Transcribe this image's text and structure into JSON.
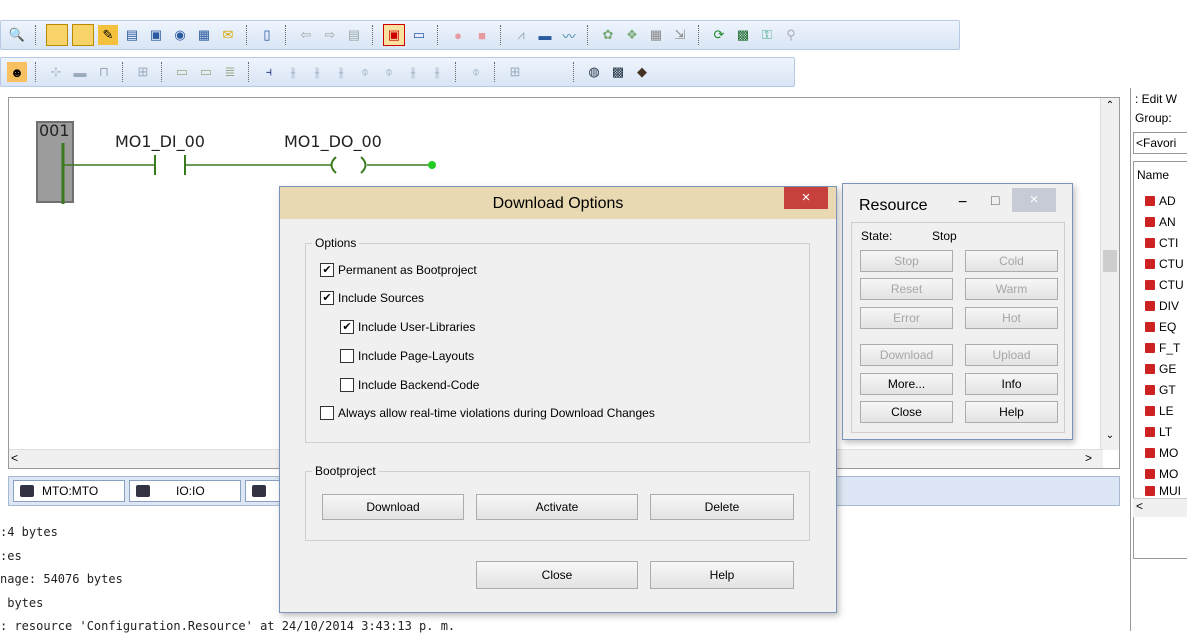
{
  "toolbar": {
    "row1_icons": [
      "search-icon",
      "window-icon",
      "window2-icon",
      "pencil-icon",
      "ladder-icon",
      "monitor-icon",
      "compile-icon",
      "memory-icon",
      "note-icon",
      "page-icon",
      "back-icon",
      "forward-icon",
      "list-icon",
      "build-icon",
      "config-icon",
      "record-icon",
      "stop-icon",
      "plot-icon",
      "view-icon",
      "wave-icon",
      "tools-icon",
      "resource-icon",
      "table-icon",
      "export-icon",
      "refresh-icon",
      "device-icon",
      "key-icon",
      "link-icon"
    ],
    "row2_icons": [
      "person-icon",
      "insert-icon",
      "block-icon",
      "branch-icon",
      "function-icon",
      "coil-icon",
      "coil2-icon",
      "stack-icon",
      "contact-no-icon",
      "contact-nc-icon",
      "contact-p-icon",
      "contact-n-icon",
      "coil-set-icon",
      "coil-reset-icon",
      "coil-p-icon",
      "coil-n-icon",
      "jump-icon",
      "return-icon",
      "globe-icon",
      "save-icon",
      "debug-icon"
    ]
  },
  "editor": {
    "rung_number": "001",
    "contact_var": "MO1_DI_00",
    "coil_var": "MO1_DO_00"
  },
  "tabs": [
    {
      "label": "MTO:MTO"
    },
    {
      "label": "IO:IO"
    }
  ],
  "output_lines": [
    ":4 bytes",
    ":es",
    "nage: 54076 bytes",
    " bytes",
    ": resource 'Configuration.Resource' at 24/10/2014 3:43:13 p. m."
  ],
  "right_panel": {
    "title": ": Edit W",
    "group_label": "Group:",
    "group_value": "<Favori",
    "column_header": "Name",
    "items": [
      "AD",
      "AN",
      "CTI",
      "CTU",
      "CTU",
      "DIV",
      "EQ",
      "F_T",
      "GE",
      "GT",
      "LE",
      "LT",
      "MO",
      "MO",
      "MUI"
    ]
  },
  "download_dialog": {
    "title": "Download Options",
    "options_group": "Options",
    "checkboxes": [
      {
        "label": "Permanent as Bootproject",
        "checked": "✔"
      },
      {
        "label": "Include Sources",
        "checked": "✔"
      },
      {
        "label": "Include User-Libraries",
        "checked": "✔"
      },
      {
        "label": "Include Page-Layouts",
        "checked": ""
      },
      {
        "label": "Include Backend-Code",
        "checked": ""
      },
      {
        "label": "Always allow real-time violations during Download Changes",
        "checked": ""
      }
    ],
    "bootproject_group": "Bootproject",
    "download_label": "Download",
    "activate_label": "Activate",
    "delete_label": "Delete",
    "close_label": "Close",
    "help_label": "Help",
    "close_icon": "×"
  },
  "resource_dialog": {
    "title": "Resource",
    "state_label": "State:",
    "state_value": "Stop",
    "buttons": {
      "stop": "Stop",
      "cold": "Cold",
      "reset": "Reset",
      "warm": "Warm",
      "error": "Error",
      "hot": "Hot",
      "download": "Download",
      "upload": "Upload",
      "more": "More...",
      "info": "Info",
      "close": "Close",
      "help": "Help"
    },
    "minimize_icon": "−",
    "maximize_icon": "□",
    "close_icon": "×"
  },
  "colors": {
    "title_bar": "#e9d9b2",
    "close_red": "#c7403b",
    "ladder_green": "#3a7a1e",
    "rung_bg": "#9c9c9c"
  }
}
